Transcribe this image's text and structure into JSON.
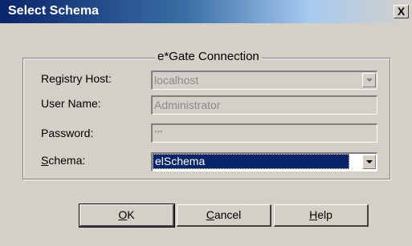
{
  "window": {
    "title": "Select Schema",
    "close_label": "X"
  },
  "group": {
    "legend": "e*Gate Connection"
  },
  "fields": {
    "registry_host": {
      "label": "Registry Host:",
      "value": "localhost"
    },
    "user_name": {
      "label": "User Name:",
      "value": "Administrator"
    },
    "password": {
      "label": "Password:",
      "value": "***"
    },
    "schema": {
      "label_mnemonic": "S",
      "label_rest": "chema:",
      "value": "elSchema"
    }
  },
  "buttons": {
    "ok": {
      "mnemonic": "O",
      "rest": "K"
    },
    "cancel": {
      "mnemonic": "C",
      "rest": "ancel"
    },
    "help": {
      "mnemonic": "H",
      "rest": "elp"
    }
  },
  "colors": {
    "titlebar_start": "#0a246a",
    "selection": "#0a246a",
    "dialog_face": "#d4d0c8"
  }
}
